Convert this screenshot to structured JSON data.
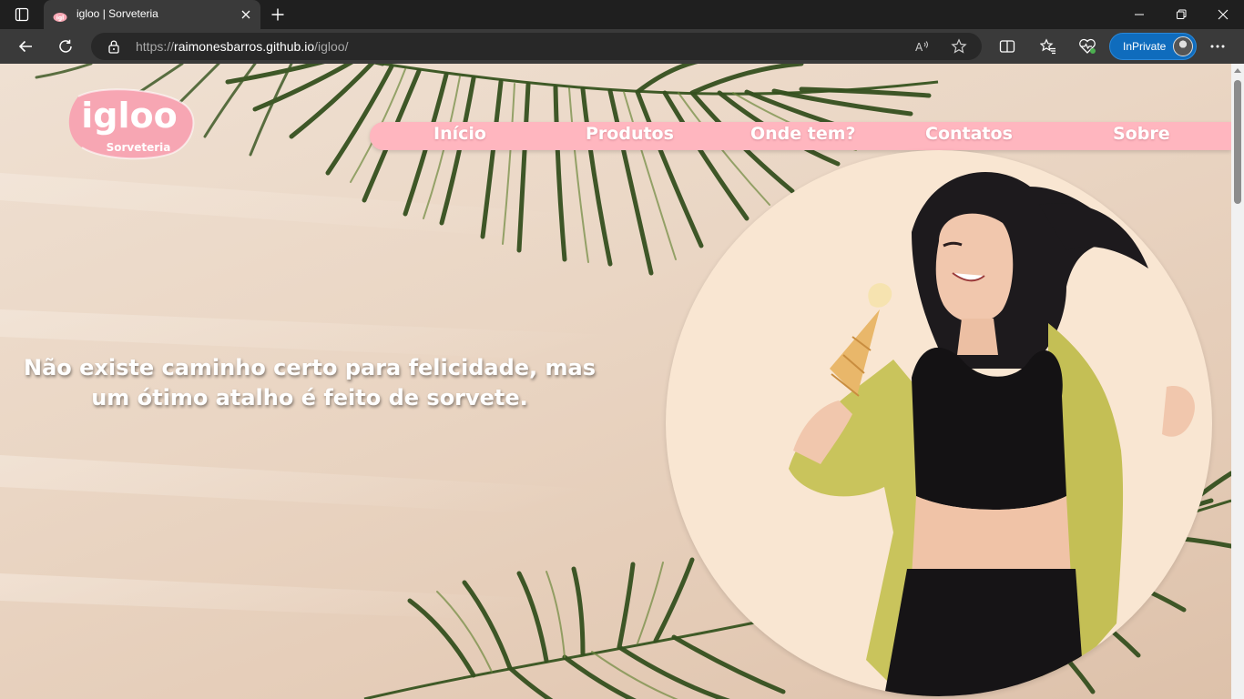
{
  "browser": {
    "tab_title": "igloo | Sorveteria",
    "url_prefix": "https://",
    "url_host": "raimonesbarros.github.io",
    "url_path": "/igloo/",
    "inprivate_label": "InPrivate"
  },
  "site": {
    "logo_text": "igloo",
    "logo_subtext": "Sorveteria",
    "menu": [
      {
        "label": "Início"
      },
      {
        "label": "Produtos"
      },
      {
        "label": "Onde tem?"
      },
      {
        "label": "Contatos"
      },
      {
        "label": "Sobre"
      }
    ],
    "quote_line1": "Não existe caminho certo para felicidade, mas",
    "quote_line2": "um ótimo atalho é feito de sorvete."
  },
  "colors": {
    "menu_bg": "#ffb6bf",
    "logo_pink": "#f7a6b3",
    "page_bg": "#ead6c4",
    "inprivate_blue": "#0f6cbd"
  },
  "icons": [
    "tab-actions-icon",
    "site-favicon-icon",
    "close-icon",
    "plus-icon",
    "minimize-icon",
    "restore-icon",
    "close-window-icon",
    "back-arrow-icon",
    "refresh-icon",
    "lock-icon",
    "read-aloud-icon",
    "favorite-star-icon",
    "split-screen-icon",
    "favorites-icon",
    "browser-essentials-icon",
    "more-icon"
  ]
}
